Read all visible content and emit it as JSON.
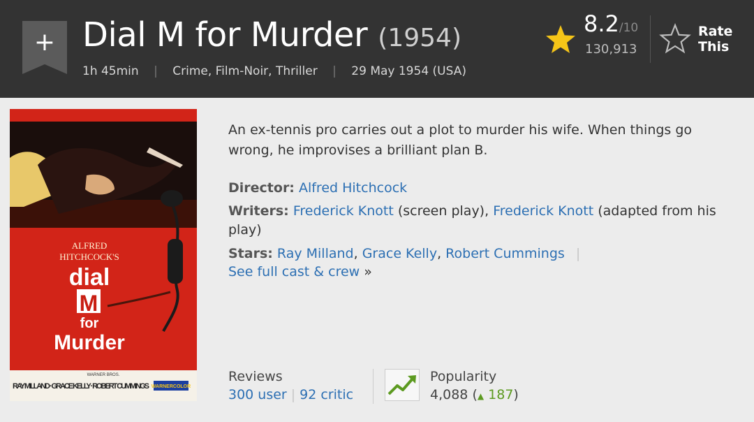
{
  "header": {
    "watchlist_symbol": "+",
    "title": "Dial M for Murder",
    "year": "(1954)",
    "runtime": "1h 45min",
    "genres": "Crime, Film-Noir, Thriller",
    "release": "29 May 1954 (USA)",
    "separator": "|"
  },
  "rating": {
    "value": "8.2",
    "best": "/10",
    "count": "130,913",
    "star_color": "#f5c518",
    "rate_label": "Rate This"
  },
  "poster": {
    "director_line1": "ALFRED",
    "director_line2": "HITCHCOCK'S",
    "title_line1": "dial",
    "title_line2": "M",
    "title_line3": "for",
    "title_line4": "Murder",
    "studio": "WARNER BROS.",
    "cast_strip": "RAY MILLAND · GRACE KELLY · ROBERT CUMMINGS",
    "color_badge": "WARNERCOLOR"
  },
  "summary": "An ex-tennis pro carries out a plot to murder his wife. When things go wrong, he improvises a brilliant plan B.",
  "credits": {
    "director_label": "Director:",
    "director": "Alfred Hitchcock",
    "writers_label": "Writers:",
    "writer1": "Frederick Knott",
    "writer1_note": "(screen play),",
    "writer2": "Frederick Knott",
    "writer2_note": "(adapted from his play)",
    "stars_label": "Stars:",
    "star1": "Ray Milland",
    "star2": "Grace Kelly",
    "star3": "Robert Cummings",
    "pipe": "|",
    "full_cast": "See full cast & crew",
    "full_cast_arrow": "»"
  },
  "reviews": {
    "label": "Reviews",
    "user": "300 user",
    "critic": "92 critic",
    "sep": "|"
  },
  "popularity": {
    "label": "Popularity",
    "value": "4,088",
    "open_paren": "(",
    "change_arrow": "▲",
    "change": "187",
    "close_paren": ")",
    "accent": "#5c9a20"
  }
}
